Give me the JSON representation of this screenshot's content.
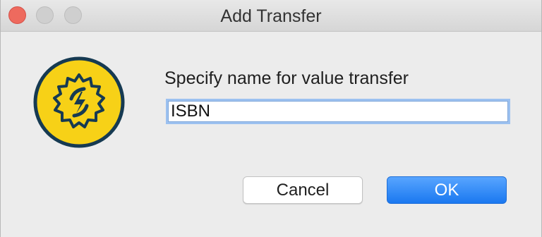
{
  "window": {
    "title": "Add Transfer",
    "traffic_lights": [
      "close",
      "minimize",
      "zoom"
    ]
  },
  "dialog": {
    "icon": "gear-lightning-icon",
    "prompt": "Specify name for value transfer",
    "name_input": {
      "value": "ISBN",
      "placeholder": ""
    },
    "buttons": {
      "cancel_label": "Cancel",
      "ok_label": "OK"
    }
  },
  "colors": {
    "accent_button": "#1a78f0",
    "icon_yellow": "#f7d117",
    "icon_navy": "#163a52",
    "close_red": "#ee6a5e"
  }
}
